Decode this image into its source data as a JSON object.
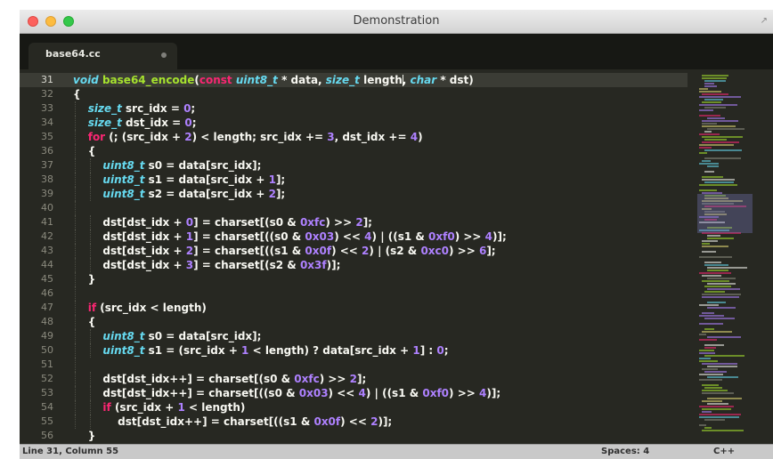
{
  "window": {
    "title": "Demonstration"
  },
  "tab": {
    "label": "base64.cc",
    "modified_indicator": "dot"
  },
  "editor": {
    "current_line": 31,
    "colors": {
      "background": "#272822",
      "type": "#66d9ef",
      "keyword": "#f92672",
      "function": "#a6e22e",
      "number": "#ae81ff",
      "text": "#f8f8f2"
    },
    "lines": [
      {
        "n": "31",
        "tokens": [
          [
            "void",
            "ty"
          ],
          [
            " ",
            ""
          ],
          [
            "base64_encode",
            "fn"
          ],
          [
            "(",
            ""
          ],
          [
            "const",
            "kw"
          ],
          [
            " ",
            ""
          ],
          [
            "uint8_t",
            "ty"
          ],
          [
            " * data, ",
            ""
          ],
          [
            "size_t",
            "ty"
          ],
          [
            " length, ",
            ""
          ],
          [
            "char",
            "ty"
          ],
          [
            " * dst)",
            ""
          ]
        ]
      },
      {
        "n": "32",
        "tokens": [
          [
            "{",
            ""
          ]
        ]
      },
      {
        "n": "33",
        "tokens": [
          [
            "    ",
            ""
          ],
          [
            "size_t",
            "ty"
          ],
          [
            " src_idx = ",
            ""
          ],
          [
            "0",
            "nm"
          ],
          [
            ";",
            ""
          ]
        ]
      },
      {
        "n": "34",
        "tokens": [
          [
            "    ",
            ""
          ],
          [
            "size_t",
            "ty"
          ],
          [
            " dst_idx = ",
            ""
          ],
          [
            "0",
            "nm"
          ],
          [
            ";",
            ""
          ]
        ]
      },
      {
        "n": "35",
        "tokens": [
          [
            "    ",
            ""
          ],
          [
            "for",
            "kw"
          ],
          [
            " (; (src_idx + ",
            ""
          ],
          [
            "2",
            "nm"
          ],
          [
            ") < length; src_idx += ",
            ""
          ],
          [
            "3",
            "nm"
          ],
          [
            ", dst_idx += ",
            ""
          ],
          [
            "4",
            "nm"
          ],
          [
            ")",
            ""
          ]
        ]
      },
      {
        "n": "36",
        "tokens": [
          [
            "    {",
            ""
          ]
        ]
      },
      {
        "n": "37",
        "tokens": [
          [
            "        ",
            ""
          ],
          [
            "uint8_t",
            "ty"
          ],
          [
            " s0 = data[src_idx];",
            ""
          ]
        ]
      },
      {
        "n": "38",
        "tokens": [
          [
            "        ",
            ""
          ],
          [
            "uint8_t",
            "ty"
          ],
          [
            " s1 = data[src_idx + ",
            ""
          ],
          [
            "1",
            "nm"
          ],
          [
            "];",
            ""
          ]
        ]
      },
      {
        "n": "39",
        "tokens": [
          [
            "        ",
            ""
          ],
          [
            "uint8_t",
            "ty"
          ],
          [
            " s2 = data[src_idx + ",
            ""
          ],
          [
            "2",
            "nm"
          ],
          [
            "];",
            ""
          ]
        ]
      },
      {
        "n": "40",
        "tokens": []
      },
      {
        "n": "41",
        "tokens": [
          [
            "        dst[dst_idx + ",
            ""
          ],
          [
            "0",
            "nm"
          ],
          [
            "] = charset[(s0 & ",
            ""
          ],
          [
            "0xfc",
            "nm"
          ],
          [
            ") >> ",
            ""
          ],
          [
            "2",
            "nm"
          ],
          [
            "];",
            ""
          ]
        ]
      },
      {
        "n": "42",
        "tokens": [
          [
            "        dst[dst_idx + ",
            ""
          ],
          [
            "1",
            "nm"
          ],
          [
            "] = charset[((s0 & ",
            ""
          ],
          [
            "0x03",
            "nm"
          ],
          [
            ") << ",
            ""
          ],
          [
            "4",
            "nm"
          ],
          [
            ") | ((s1 & ",
            ""
          ],
          [
            "0xf0",
            "nm"
          ],
          [
            ") >> ",
            ""
          ],
          [
            "4",
            "nm"
          ],
          [
            ")];",
            ""
          ]
        ]
      },
      {
        "n": "43",
        "tokens": [
          [
            "        dst[dst_idx + ",
            ""
          ],
          [
            "2",
            "nm"
          ],
          [
            "] = charset[((s1 & ",
            ""
          ],
          [
            "0x0f",
            "nm"
          ],
          [
            ") << ",
            ""
          ],
          [
            "2",
            "nm"
          ],
          [
            ") | (s2 & ",
            ""
          ],
          [
            "0xc0",
            "nm"
          ],
          [
            ") >> ",
            ""
          ],
          [
            "6",
            "nm"
          ],
          [
            "];",
            ""
          ]
        ]
      },
      {
        "n": "44",
        "tokens": [
          [
            "        dst[dst_idx + ",
            ""
          ],
          [
            "3",
            "nm"
          ],
          [
            "] = charset[(s2 & ",
            ""
          ],
          [
            "0x3f",
            "nm"
          ],
          [
            ")];",
            ""
          ]
        ]
      },
      {
        "n": "45",
        "tokens": [
          [
            "    }",
            ""
          ]
        ]
      },
      {
        "n": "46",
        "tokens": []
      },
      {
        "n": "47",
        "tokens": [
          [
            "    ",
            ""
          ],
          [
            "if",
            "kw"
          ],
          [
            " (src_idx < length)",
            ""
          ]
        ]
      },
      {
        "n": "48",
        "tokens": [
          [
            "    {",
            ""
          ]
        ]
      },
      {
        "n": "49",
        "tokens": [
          [
            "        ",
            ""
          ],
          [
            "uint8_t",
            "ty"
          ],
          [
            " s0 = data[src_idx];",
            ""
          ]
        ]
      },
      {
        "n": "50",
        "tokens": [
          [
            "        ",
            ""
          ],
          [
            "uint8_t",
            "ty"
          ],
          [
            " s1 = (src_idx + ",
            ""
          ],
          [
            "1",
            "nm"
          ],
          [
            " < length) ? data[src_idx + ",
            ""
          ],
          [
            "1",
            "nm"
          ],
          [
            "] : ",
            ""
          ],
          [
            "0",
            "nm"
          ],
          [
            ";",
            ""
          ]
        ]
      },
      {
        "n": "51",
        "tokens": []
      },
      {
        "n": "52",
        "tokens": [
          [
            "        dst[dst_idx++] = charset[(s0 & ",
            ""
          ],
          [
            "0xfc",
            "nm"
          ],
          [
            ") >> ",
            ""
          ],
          [
            "2",
            "nm"
          ],
          [
            "];",
            ""
          ]
        ]
      },
      {
        "n": "53",
        "tokens": [
          [
            "        dst[dst_idx++] = charset[((s0 & ",
            ""
          ],
          [
            "0x03",
            "nm"
          ],
          [
            ") << ",
            ""
          ],
          [
            "4",
            "nm"
          ],
          [
            ") | ((s1 & ",
            ""
          ],
          [
            "0xf0",
            "nm"
          ],
          [
            ") >> ",
            ""
          ],
          [
            "4",
            "nm"
          ],
          [
            ")];",
            ""
          ]
        ]
      },
      {
        "n": "54",
        "tokens": [
          [
            "        ",
            ""
          ],
          [
            "if",
            "kw"
          ],
          [
            " (src_idx + ",
            ""
          ],
          [
            "1",
            "nm"
          ],
          [
            " < length)",
            ""
          ]
        ]
      },
      {
        "n": "55",
        "tokens": [
          [
            "            dst[dst_idx++] = charset[((s1 & ",
            ""
          ],
          [
            "0x0f",
            "nm"
          ],
          [
            ") << ",
            ""
          ],
          [
            "2",
            "nm"
          ],
          [
            ")];",
            ""
          ]
        ]
      },
      {
        "n": "56",
        "tokens": [
          [
            "    }",
            ""
          ]
        ]
      }
    ]
  },
  "status": {
    "position": "Line 31, Column 55",
    "spaces": "Spaces: 4",
    "syntax": "C++"
  }
}
